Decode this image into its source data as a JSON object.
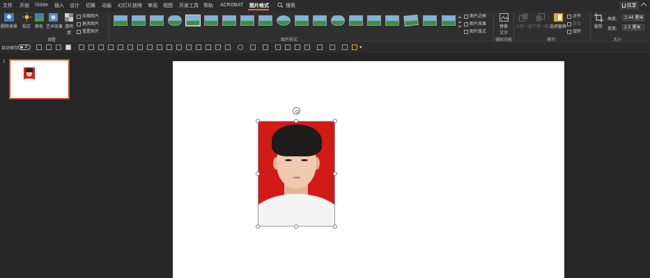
{
  "menu": {
    "tabs": [
      "文件",
      "开始",
      "iSlide",
      "插入",
      "设计",
      "切换",
      "动画",
      "幻灯片放映",
      "审阅",
      "视图",
      "开发工具",
      "帮助",
      "ACROBAT",
      "图片格式"
    ],
    "search_label": "搜索",
    "share_label": "共享"
  },
  "ribbon": {
    "adjust": {
      "remove_bg": "删除背景",
      "correct": "校正",
      "color": "颜色",
      "artistic": "艺术效果",
      "transparency": "透明度",
      "compress": "压缩图片",
      "change": "更改图片",
      "reset": "重置图片",
      "group_label": "调整"
    },
    "styles": {
      "group_label": "图片样式",
      "border": "图片边框",
      "effects": "图片效果",
      "layout": "图片版式"
    },
    "accessibility": {
      "alt_text": "替换文字",
      "group_label": "辅助功能"
    },
    "arrange": {
      "bring_forward": "上移一层",
      "send_backward": "下移一层",
      "selection_pane": "选择窗格",
      "align": "对齐",
      "group": "组合",
      "rotate": "旋转",
      "group_label": "排列"
    },
    "size": {
      "crop": "裁剪",
      "height_label": "高度:",
      "height_value": "3.44 厘米",
      "width_label": "宽度:",
      "width_value": "2.5 厘米",
      "group_label": "大小"
    }
  },
  "qat": {
    "autosave_label": "自动保存",
    "autosave_state": "关"
  },
  "thumbnails": {
    "slide_number": "1"
  }
}
